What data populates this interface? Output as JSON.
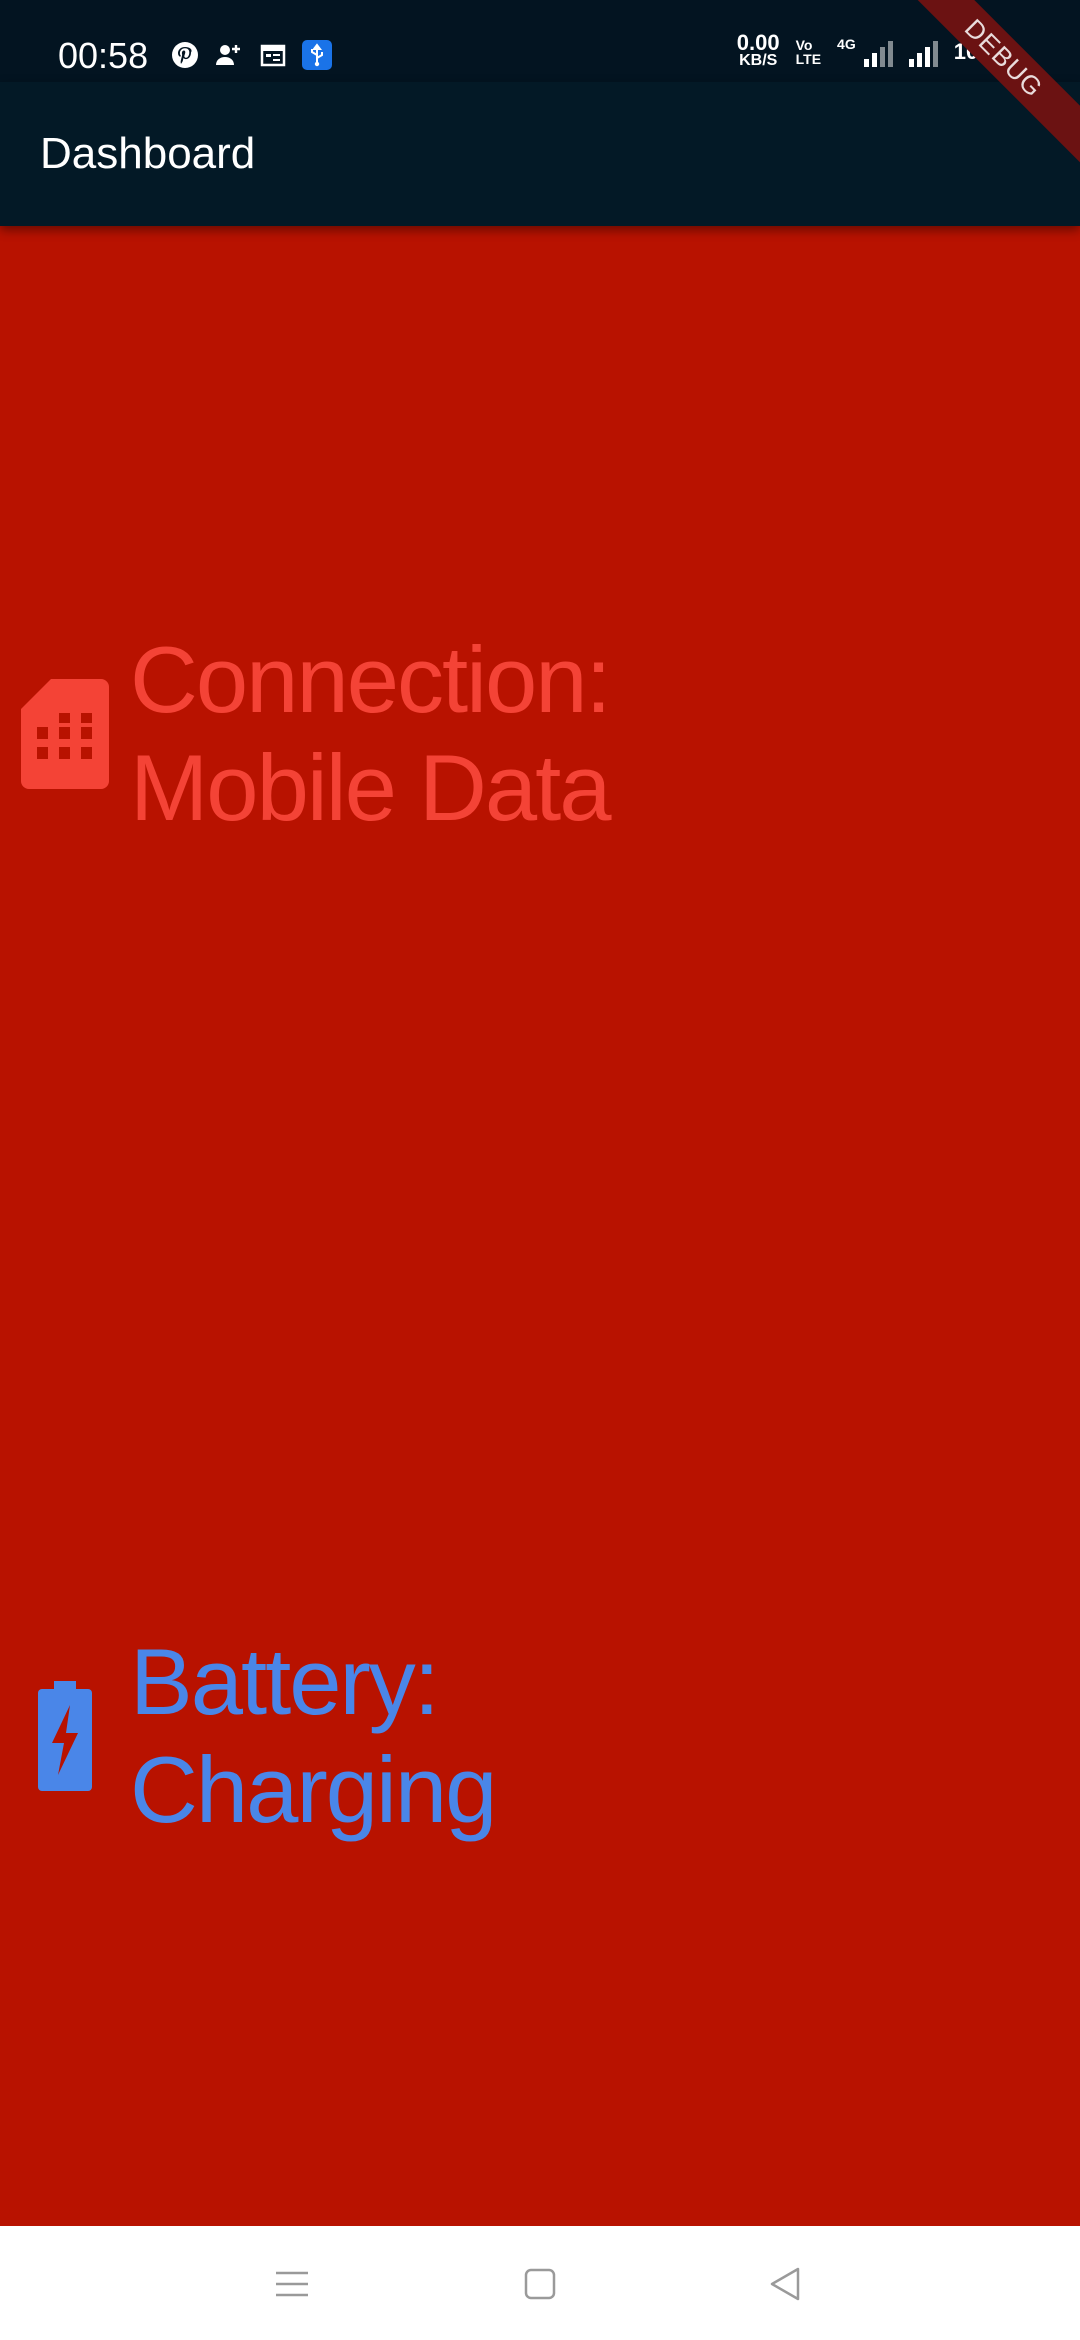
{
  "status_bar": {
    "time": "00:58",
    "net_speed_value": "0.00",
    "net_speed_unit": "KB/S",
    "volte_top": "Vo",
    "volte_bottom": "LTE",
    "network_type": "4G",
    "battery_percent": "100%",
    "left_icons": [
      "pinterest-icon",
      "add-person-icon",
      "calendar-icon",
      "usb-icon"
    ]
  },
  "debug_banner": "DEBUG",
  "app_bar": {
    "title": "Dashboard"
  },
  "connection": {
    "label": "Connection:",
    "value": "Mobile Data",
    "icon": "sim-card-icon",
    "color": "#f44336"
  },
  "battery": {
    "label": "Battery:",
    "value": "Charging",
    "icon": "battery-charging-icon",
    "color": "#4a86e8"
  },
  "nav_bar": {
    "buttons": [
      "menu-icon",
      "home-icon",
      "back-icon"
    ]
  },
  "colors": {
    "background": "#b81200",
    "app_bar": "#031926",
    "status_bar": "#031421"
  }
}
